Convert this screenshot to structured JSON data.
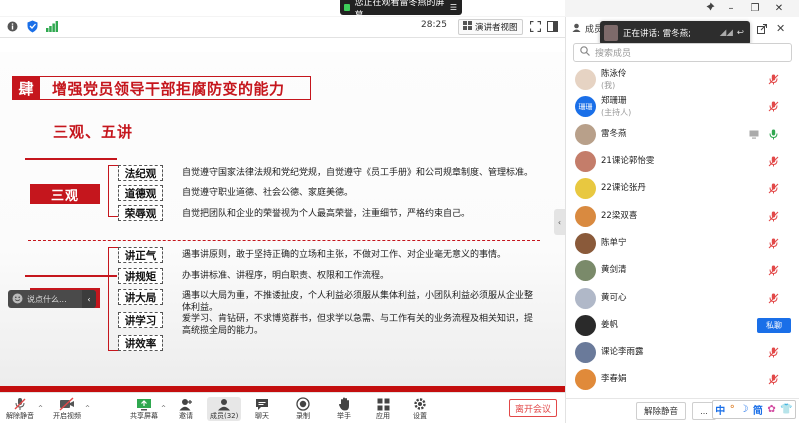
{
  "top_banner": {
    "status": "您正在观看雷冬燕的屏幕",
    "menu_glyph": "☰"
  },
  "toolbar": {
    "time": "28:25",
    "view_mode": "演讲者视图"
  },
  "slide": {
    "number_char": "肆",
    "title": "增强党员领导干部拒腐防变的能力",
    "subtitle": "三观、五讲",
    "groups": [
      {
        "category": "三观",
        "items": [
          {
            "term": "法纪观",
            "desc": "自觉遵守国家法律法规和党纪党规，自觉遵守《员工手册》和公司规章制度、管理标准。"
          },
          {
            "term": "道德观",
            "desc": "自觉遵守职业道德、社会公德、家庭美德。"
          },
          {
            "term": "荣辱观",
            "desc": "自觉把团队和企业的荣誉视为个人最高荣誉，注重细节，严格约束自己。"
          }
        ]
      },
      {
        "category": "五讲",
        "items": [
          {
            "term": "讲正气",
            "desc": "遇事讲原则，敢于坚持正确的立场和主张，不做对工作、对企业毫无意义的事情。"
          },
          {
            "term": "讲规矩",
            "desc": "办事讲标准、讲程序，明白职责、权限和工作流程。"
          },
          {
            "term": "讲大局",
            "desc": "遇事以大局为重，不推诿扯皮，个人利益必须服从集体利益，小团队利益必须服从企业整体利益。"
          },
          {
            "term": "讲学习",
            "desc": "爱学习、肯钻研，不求博览群书，但求学以急需、与工作有关的业务流程及相关知识，提高统揽全局的能力。"
          },
          {
            "term": "讲效率",
            "desc": ""
          }
        ]
      }
    ],
    "chat_placeholder": "说点什么..."
  },
  "bottom_bar": {
    "buttons": [
      {
        "label": "解除静音",
        "icon": "mic-muted-icon"
      },
      {
        "label": "开启视频",
        "icon": "camera-off-icon"
      },
      {
        "label": "共享屏幕",
        "icon": "share-screen-icon"
      },
      {
        "label": "邀请",
        "icon": "invite-icon"
      },
      {
        "label": "成员(32)",
        "icon": "members-icon"
      },
      {
        "label": "聊天",
        "icon": "chat-icon"
      },
      {
        "label": "录制",
        "icon": "record-icon"
      },
      {
        "label": "举手",
        "icon": "hand-icon"
      },
      {
        "label": "应用",
        "icon": "apps-icon"
      },
      {
        "label": "设置",
        "icon": "settings-icon"
      }
    ],
    "leave_label": "离开会议"
  },
  "right_panel": {
    "title": "成员",
    "speaking_popup": "正在讲话: 雷冬燕;",
    "search_placeholder": "搜索成员",
    "members": [
      {
        "name": "陈泳伶",
        "role": "(我)",
        "avatar_color": "#e6d3c3"
      },
      {
        "name": "郑珊珊",
        "role": "(主持人)",
        "avatar_color": "#1a6fe8",
        "avatar_text": "珊珊"
      },
      {
        "name": "雷冬燕",
        "role": "",
        "avatar_color": "#b8a08a",
        "speaking": true
      },
      {
        "name": "21课论郭怡雯",
        "role": "",
        "avatar_color": "#c47d6a"
      },
      {
        "name": "22课论张丹",
        "role": "",
        "avatar_color": "#e8c840"
      },
      {
        "name": "22梁双喜",
        "role": "",
        "avatar_color": "#d98a40"
      },
      {
        "name": "陈单宁",
        "role": "",
        "avatar_color": "#8a5a3a"
      },
      {
        "name": "黄剑清",
        "role": "",
        "avatar_color": "#7a8a6a"
      },
      {
        "name": "黄可心",
        "role": "",
        "avatar_color": "#b0b8c8"
      },
      {
        "name": "姜帆",
        "role": "",
        "avatar_color": "#2a2a2a",
        "private_label": "私聊"
      },
      {
        "name": "课论李雨露",
        "role": "",
        "avatar_color": "#6a7a9a"
      },
      {
        "name": "李春娟",
        "role": "",
        "avatar_color": "#e08a3a"
      }
    ],
    "mute_all_label": "解除静音",
    "more_label": "..."
  },
  "ime": {
    "chars": [
      "中",
      "°",
      "☽",
      "简",
      "✿",
      "👕"
    ]
  },
  "colors": {
    "accent_red": "#c5161d",
    "primary_blue": "#1a6fe8",
    "muted_red": "#e24848"
  }
}
